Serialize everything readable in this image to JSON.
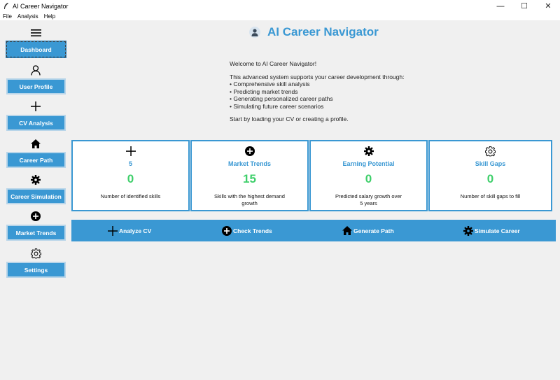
{
  "window": {
    "title": "AI Career Navigator",
    "controls": {
      "minimize": "—",
      "maximize": "☐",
      "close": "✕"
    }
  },
  "menubar": {
    "items": [
      "File",
      "Analysis",
      "Help"
    ]
  },
  "sidebar": {
    "items": [
      {
        "label": "Dashboard",
        "icon": "menu-icon",
        "active": true
      },
      {
        "label": "User Profile",
        "icon": "user-icon"
      },
      {
        "label": "CV Analysis",
        "icon": "plus-icon"
      },
      {
        "label": "Career Path",
        "icon": "home-icon"
      },
      {
        "label": "Career Simulation",
        "icon": "gear-filled-icon"
      },
      {
        "label": "Market Trends",
        "icon": "plus-circle-icon"
      },
      {
        "label": "Settings",
        "icon": "gear-outline-icon"
      }
    ]
  },
  "header": {
    "title": "AI Career Navigator",
    "icon": "avatar-icon"
  },
  "welcome": {
    "greeting": "Welcome to AI Career Navigator!",
    "intro": "This advanced system supports your career development through:",
    "bullets": [
      "• Comprehensive skill analysis",
      "• Predicting market trends",
      "• Generating personalized career paths",
      "• Simulating future career scenarios"
    ],
    "cta": "Start by loading your CV or creating a profile."
  },
  "cards": [
    {
      "title": "5",
      "value": "0",
      "desc": "Number of identified skills",
      "icon": "plus-icon"
    },
    {
      "title": "Market Trends",
      "value": "15",
      "desc": "Skills with the highest demand growth",
      "icon": "plus-circle-icon"
    },
    {
      "title": "Earning Potential",
      "value": "0",
      "desc": "Predicted salary growth over 5 years",
      "icon": "gear-filled-icon"
    },
    {
      "title": "Skill Gaps",
      "value": "0",
      "desc": "Number of skill gaps to fill",
      "icon": "gear-outline-icon"
    }
  ],
  "actions": [
    {
      "label": "Analyze CV",
      "icon": "plus-icon"
    },
    {
      "label": "Check Trends",
      "icon": "plus-circle-icon"
    },
    {
      "label": "Generate Path",
      "icon": "home-icon"
    },
    {
      "label": "Simulate Career",
      "icon": "gear-filled-icon"
    }
  ],
  "colors": {
    "accent": "#3a98d3",
    "value_green": "#3ecf6a",
    "background": "#f0f0f0"
  }
}
